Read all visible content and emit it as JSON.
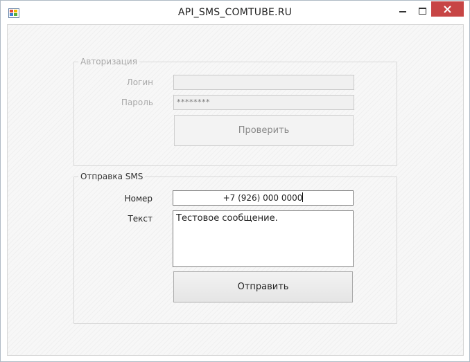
{
  "window": {
    "title": "API_SMS_COMTUBE.RU",
    "controls": {
      "minimize": "–",
      "maximize": "□",
      "close": "✕"
    }
  },
  "auth": {
    "legend": "Авторизация",
    "login_label": "Логин",
    "login_value": "",
    "password_label": "Пароль",
    "password_value": "********",
    "check_button": "Проверить"
  },
  "sms": {
    "legend": "Отправка SMS",
    "number_label": "Номер",
    "number_value": "+7 (926) 000 0000",
    "text_label": "Текст",
    "text_value": "Тестовое сообщение.",
    "send_button": "Отправить"
  },
  "colors": {
    "close_button": "#c74545",
    "disabled_text": "#a9a9a9"
  }
}
